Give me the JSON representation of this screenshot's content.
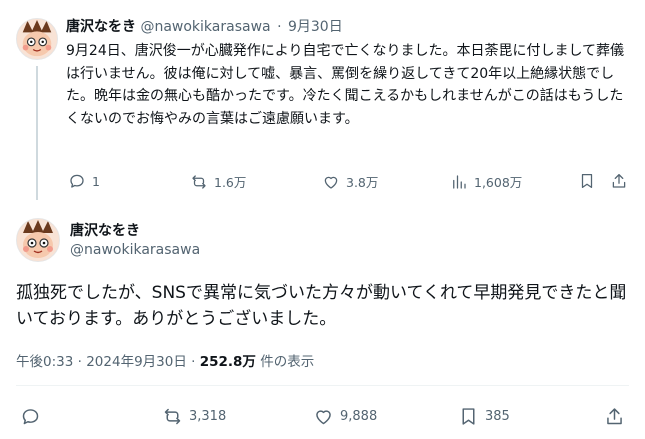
{
  "tweet1": {
    "display_name": "唐沢なをき",
    "handle": "@nawokikarasawa",
    "separator": "·",
    "date": "9月30日",
    "text": "9月24日、唐沢俊一が心臓発作により自宅で亡くなりました。本日荼毘に付しまして葬儀は行いません。彼は俺に対して嘘、暴言、罵倒を繰り返してきて20年以上絶縁状態でした。晩年は金の無心も酷かったです。冷たく聞こえるかもしれませんがこの話はもうしたくないのでお悔やみの言葉はご遠慮願います。",
    "replies": "1",
    "reposts": "1.6万",
    "likes": "3.8万",
    "views": "1,608万"
  },
  "tweet2": {
    "display_name": "唐沢なをき",
    "handle": "@nawokikarasawa",
    "text": "孤独死でしたが、SNSで異常に気づいた方々が動いてくれて早期発見できたと聞いております。ありがとうございました。",
    "time": "午後0:33",
    "separator": "·",
    "date": "2024年9月30日",
    "views_count": "252.8万",
    "views_label": "件の表示",
    "replies": "",
    "reposts": "3,318",
    "likes": "9,888",
    "bookmarks": "385"
  },
  "icons": {
    "reply": "reply-icon",
    "repost": "repost-icon",
    "like": "heart-icon",
    "views": "analytics-icon",
    "bookmark": "bookmark-icon",
    "share": "share-icon"
  },
  "colors": {
    "text_primary": "#0f1419",
    "text_secondary": "#536471",
    "thread_line": "#cfd9de",
    "divider": "#eff3f4"
  }
}
